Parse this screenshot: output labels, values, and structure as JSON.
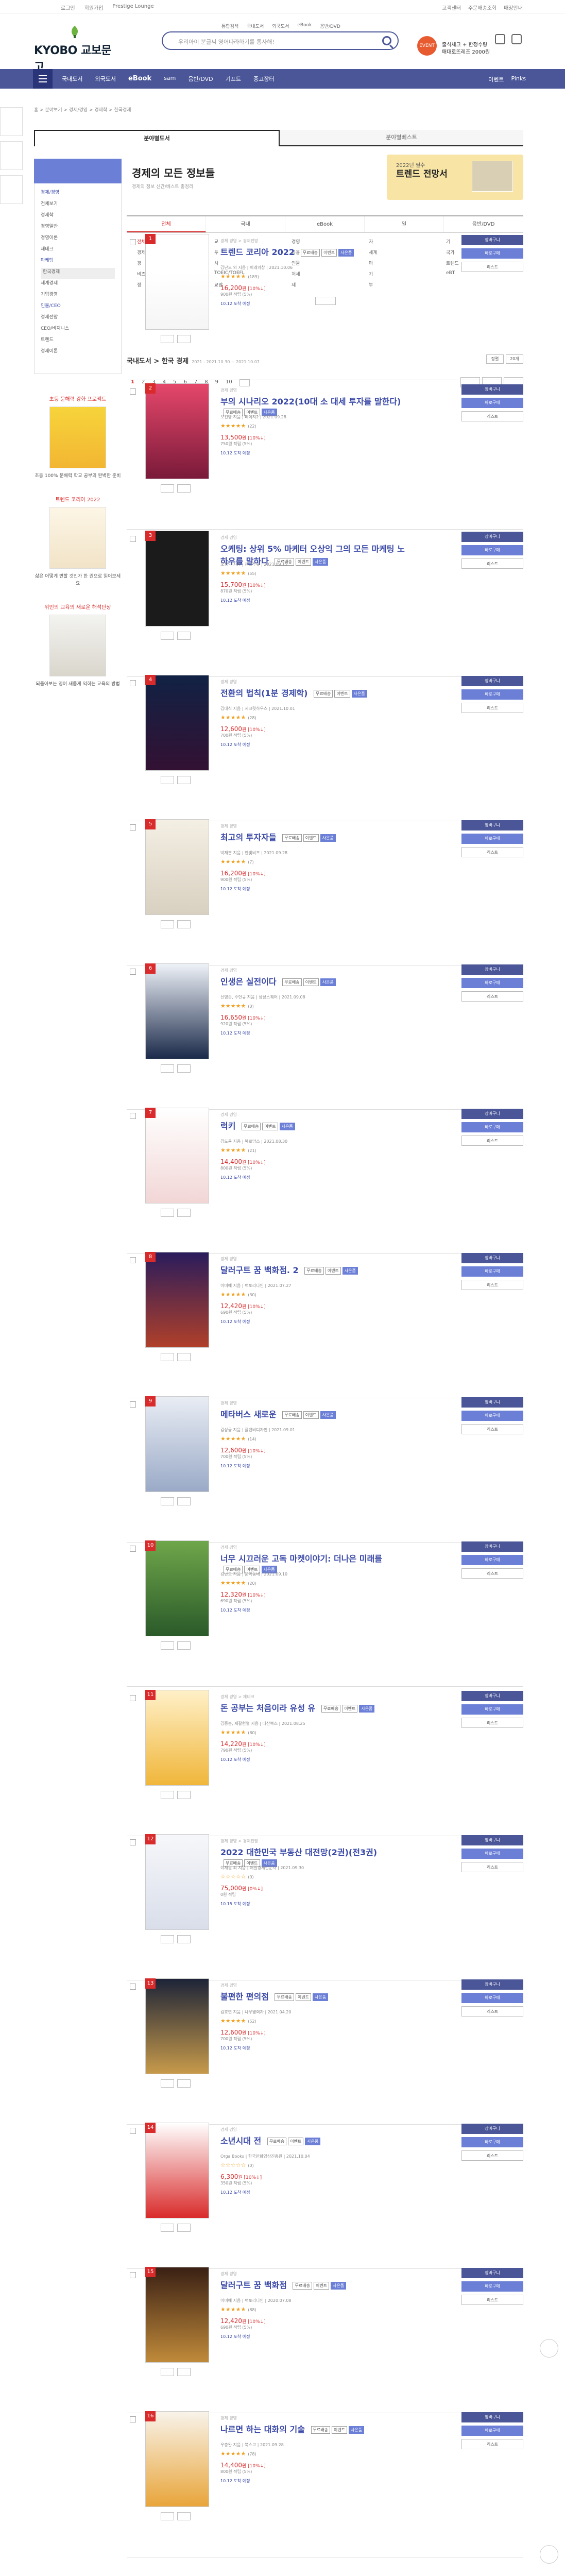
{
  "topbar": {
    "left": [
      "로그인",
      "회원가입",
      "Prestige Lounge"
    ],
    "right": [
      "고객센터",
      "주문배송조회",
      "매장안내"
    ]
  },
  "header": {
    "logo_text": "KYOBO 교보문고",
    "search_tabs": [
      "통합검색",
      "국내도서",
      "외국도서",
      "eBook",
      "음반/DVD"
    ],
    "search_placeholder": "우리아이 분글씨 영어따라하기를 통사해!",
    "promo_badge": "EVENT",
    "promo_line1": "출석체크 + 한정수량",
    "promo_line2": "매대로뜨레즈 2000원"
  },
  "nav": {
    "items": [
      "국내도서",
      "외국도서",
      "eBook",
      "sam",
      "음반/DVD",
      "기프트",
      "중고장터"
    ],
    "right": [
      "이벤트",
      "Pinks"
    ]
  },
  "breadcrumb": "홈 > 분야보기 > 경제/경영 > 경제학 > 한국경제",
  "tabs": [
    "분야별도서",
    "분야별베스트"
  ],
  "sidebar": {
    "items": [
      "경제/경영",
      "전체보기",
      "경제학",
      "경영일반",
      "경영이론",
      "재테크",
      "마케팅",
      "한국경제",
      "세계경제",
      "기업경영",
      "인물/CEO",
      "경제전망",
      "CEO/비지니스",
      "트렌드",
      "경제이론"
    ],
    "ads": [
      {
        "title": "초등 문해력 강화 프로젝트",
        "caption": "초등 100% 문해력 학교 공부의 완벽한 준비"
      },
      {
        "title": "트렌드 코리아 2022",
        "caption": "삶은 어떻게 변할 것인가 한 권으로 읽어보세요"
      },
      {
        "title": "위인의 교육의 새로운 해석단상",
        "caption": "되돌아보는 영어 새롭게 익히는 교육의 방법"
      }
    ]
  },
  "content": {
    "title": "경제의 모든 정보들",
    "subtitle": "경제의 정보 신간/베스트 총정리",
    "banner_small": "2022년 필수",
    "banner_big": "트렌드 전망서"
  },
  "filter": {
    "tabs": [
      "전체",
      "국내",
      "eBook",
      "일",
      "음반/DVD"
    ],
    "grid": [
      "전체",
      "교",
      "경영",
      "자",
      "기",
      "경제",
      "투",
      "금융",
      "세계",
      "국가",
      "경",
      "사",
      "인물",
      "마",
      "트렌드",
      "비즈",
      "TOEIC/TOEFL",
      "처세",
      "기",
      "eBT",
      "정",
      "교양",
      "제",
      "부"
    ]
  },
  "list": {
    "heading": "국내도서 > 한국 경제",
    "range": "2021 - 2021.10.30 ~ 2021.10.07",
    "sort_options": [
      "정렬",
      "20개"
    ],
    "pages": [
      "1",
      "2",
      "3",
      "4",
      "5",
      "6",
      "7",
      "8",
      "9",
      "10"
    ]
  },
  "items": [
    {
      "rank": "1",
      "cat": "경제 경영 > 경제전망",
      "title": "트렌드 코리아 2022",
      "meta": "김난도 외 지음 | 미래의창 | 2021.10.06",
      "stars": "★★★★★",
      "reviews": "(189)",
      "price": "16,200",
      "discount": "[10%↓]",
      "points": "900원 적립 (5%)",
      "delivery": "10.12 도착 예정"
    },
    {
      "rank": "2",
      "cat": "경제 경영",
      "title": "부의 시나리오 2022(10대 소 대세 투자를 말한다)",
      "meta": "오건영 지음 | 페이지2 | 2021.09.28",
      "stars": "★★★★★",
      "reviews": "(22)",
      "price": "13,500",
      "discount": "[10%↓]",
      "points": "750원 적립 (5%)",
      "delivery": "10.12 도착 예정"
    },
    {
      "rank": "3",
      "cat": "경제 경영",
      "title": "오케팅: 상위 5% 마케터 오상익 그의 모든 마케팅 노하우를 말하다",
      "meta": "오상익 지음 | 천그루숲 | 2021.09.15",
      "stars": "★★★★★",
      "reviews": "(55)",
      "price": "15,700",
      "discount": "[10%↓]",
      "points": "870원 적립 (5%)",
      "delivery": "10.12 도착 예정"
    },
    {
      "rank": "4",
      "cat": "경제 경영",
      "title": "전환의 법칙(1분 경제학)",
      "meta": "김대식 지음 | 시크릿하우스 | 2021.10.01",
      "stars": "★★★★★",
      "reviews": "(28)",
      "price": "12,600",
      "discount": "[10%↓]",
      "points": "700원 적립 (5%)",
      "delivery": "10.12 도착 예정"
    },
    {
      "rank": "5",
      "cat": "경제 경영",
      "title": "최고의 투자자들",
      "meta": "박재훈 지음 | 한빛비즈 | 2021.09.28",
      "stars": "★★★★★",
      "reviews": "(7)",
      "price": "16,200",
      "discount": "[10%↓]",
      "points": "900원 적립 (5%)",
      "delivery": "10.12 도착 예정"
    },
    {
      "rank": "6",
      "cat": "경제 경영",
      "title": "인생은 실전이다",
      "meta": "신영준, 주언규 지음 | 상상스퀘어 | 2021.09.08",
      "stars": "★★★★★",
      "reviews": "(0)",
      "price": "16,650",
      "discount": "[10%↓]",
      "points": "920원 적립 (5%)",
      "delivery": "10.12 도착 예정"
    },
    {
      "rank": "7",
      "cat": "경제 경영",
      "title": "럭키",
      "meta": "김도윤 지음 | 북로망스 | 2021.08.30",
      "stars": "★★★★★",
      "reviews": "(21)",
      "price": "14,400",
      "discount": "[10%↓]",
      "points": "800원 적립 (5%)",
      "delivery": "10.12 도착 예정"
    },
    {
      "rank": "8",
      "cat": "경제 경영",
      "title": "달러구트 꿈 백화점. 2",
      "meta": "이미예 지음 | 팩토리나인 | 2021.07.27",
      "stars": "★★★★★",
      "reviews": "(30)",
      "price": "12,420",
      "discount": "[10%↓]",
      "points": "690원 적립 (5%)",
      "delivery": "10.12 도착 예정"
    },
    {
      "rank": "9",
      "cat": "경제 경영",
      "title": "메타버스 새로운",
      "meta": "김상균 지음 | 플랜비디자인 | 2021.09.01",
      "stars": "★★★★★",
      "reviews": "(14)",
      "price": "12,600",
      "discount": "[10%↓]",
      "points": "700원 적립 (5%)",
      "delivery": "10.12 도착 예정"
    },
    {
      "rank": "10",
      "cat": "경제 경영",
      "title": "너무 시끄러운 고독 마켓이야기: 더나은 미래를",
      "meta": "김난도 지음 | 문학동네 | 2021.09.10",
      "stars": "★★★★★",
      "reviews": "(20)",
      "price": "12,320",
      "discount": "[10%↓]",
      "points": "690원 적립 (5%)",
      "delivery": "10.12 도착 예정"
    },
    {
      "rank": "11",
      "cat": "경제 경영 > 재테크",
      "title": "돈 공부는 처음이라 유성 유",
      "meta": "김종봉, 제갈현열 지음 | 다산북스 | 2021.08.25",
      "stars": "★★★★★",
      "reviews": "(80)",
      "price": "14,220",
      "discount": "[10%↓]",
      "points": "790원 적립 (5%)",
      "delivery": "10.12 도착 예정"
    },
    {
      "rank": "12",
      "cat": "경제 경영 > 경제전망",
      "title": "2022 대한민국 부동산 대전망(2권)(전3권)",
      "meta": "이재원 외 지음 | 매일경제신문사 | 2021.09.30",
      "stars": "☆☆☆☆☆",
      "reviews": "(0)",
      "price": "75,000",
      "discount": "[0%↓]",
      "points": "0원 적립",
      "delivery": "10.15 도착 예정"
    },
    {
      "rank": "13",
      "cat": "경제 경영",
      "title": "불편한 편의점",
      "meta": "김호연 지음 | 나무옆의자 | 2021.04.20",
      "stars": "★★★★★",
      "reviews": "(52)",
      "price": "12,600",
      "discount": "[10%↓]",
      "points": "700원 적립 (5%)",
      "delivery": "10.12 도착 예정"
    },
    {
      "rank": "14",
      "cat": "경제 경영",
      "title": "소년시대 전",
      "meta": "Orga Books | 한국만화영상진흥원 | 2021.10.04",
      "stars": "☆☆☆☆☆",
      "reviews": "(0)",
      "price": "6,300",
      "discount": "[10%↓]",
      "points": "350원 적립 (5%)",
      "delivery": "10.12 도착 예정"
    },
    {
      "rank": "15",
      "cat": "경제 경영",
      "title": "달러구트 꿈 백화점",
      "meta": "이미예 지음 | 팩토리나인 | 2020.07.08",
      "stars": "★★★★★",
      "reviews": "(88)",
      "price": "12,420",
      "discount": "[10%↓]",
      "points": "690원 적립 (5%)",
      "delivery": "10.12 도착 예정"
    },
    {
      "rank": "16",
      "cat": "경제 경영",
      "title": "나르면 하는 대화의 기술",
      "meta": "우충완 지음 | 북스고 | 2021.09.28",
      "stars": "★★★★★",
      "reviews": "(78)",
      "price": "14,400",
      "discount": "[10%↓]",
      "points": "800원 적립 (5%)",
      "delivery": "10.12 도착 예정"
    }
  ],
  "buttons": {
    "cart": "장바구니",
    "buy": "바로구매",
    "wish": "리스트"
  },
  "colors": {
    "brand": "#4a5698",
    "accent": "#d92b2b",
    "link": "#3a49a8"
  }
}
